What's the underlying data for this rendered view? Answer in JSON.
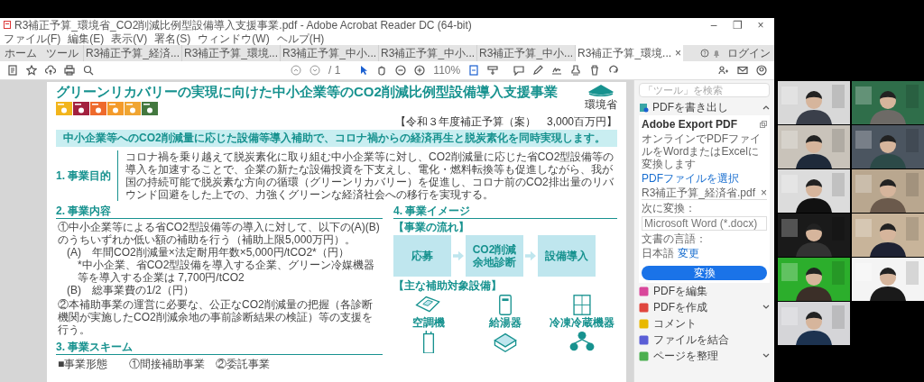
{
  "window": {
    "title": "R3補正予算_環境省_CO2削減比例型設備導入支援事業.pdf - Adobe Acrobat Reader DC (64-bit)",
    "controls": [
      "–",
      "❐",
      "×"
    ]
  },
  "menu": [
    "ファイル(F)",
    "編集(E)",
    "表示(V)",
    "署名(S)",
    "ウィンドウ(W)",
    "ヘルプ(H)"
  ],
  "tabs": [
    {
      "label": "ホーム",
      "selected": false
    },
    {
      "label": "ツール",
      "selected": false
    },
    {
      "label": "R3補正予算_経済...",
      "selected": false
    },
    {
      "label": "R3補正予算_環境...",
      "selected": false
    },
    {
      "label": "R3補正予算_中小...",
      "selected": false
    },
    {
      "label": "R3補正予算_中小...",
      "selected": false
    },
    {
      "label": "R3補正予算_中小...",
      "selected": false
    },
    {
      "label": "R3補正予算_環境...",
      "selected": true,
      "close": "×"
    }
  ],
  "account": {
    "login": "ログイン"
  },
  "toolbar": {
    "page": "/ 1",
    "zoom": "110%"
  },
  "document": {
    "title": "グリーンリカバリーの実現に向けた中小企業等のCO2削減比例型設備導入支援事業",
    "ministry": "環境省",
    "goal_tiles": [
      {
        "color": "#f2b51c"
      },
      {
        "color": "#a3213f"
      },
      {
        "color": "#ee6a2c"
      },
      {
        "color": "#f49b2a"
      },
      {
        "color": "#f0a531"
      },
      {
        "color": "#43783f"
      }
    ],
    "budget": "【令和３年度補正予算（案）　3,000百万円】",
    "summary": "中小企業等へのCO2削減量に応じた設備等導入補助で、コロナ禍からの経済再生と脱炭素化を同時実現します。",
    "purpose": {
      "heading": "1. 事業目的",
      "text": "コロナ禍を乗り越えて脱炭素化に取り組む中小企業等に対し、CO2削減量に応じた省CO2型設備等の導入を加速することで、企業の新たな設備投資を下支えし、電化・燃料転換等も促進しながら、我が国の持続可能で脱炭素な方向の循環（グリーンリカバリー）を促進し、コロナ前のCO2排出量のリバウンド回避をした上での、力強くグリーンな経済社会への移行を実現する。"
    },
    "content": {
      "heading": "2. 事業内容",
      "items": [
        {
          "kind": "main",
          "text": "①中小企業等による省CO2型設備等の導入に対して、以下の(A)(B)のうちいずれか低い額の補助を行う（補助上限5,000万円）。"
        },
        {
          "kind": "sub",
          "text": "(A)　年間CO2削減量×法定耐用年数×5,000円/tCO2*（円）"
        },
        {
          "kind": "note",
          "text": "*中小企業、省CO2型設備を導入する企業、グリーン冷媒機器等を導入する企業は 7,700円/tCO2"
        },
        {
          "kind": "sub",
          "text": "(B)　総事業費の1/2（円）"
        },
        {
          "kind": "main",
          "text": "②本補助事業の運営に必要な、公正なCO2削減量の把握（各診断機関が実施したCO2削減余地の事前診断結果の検証）等の支援を行う。"
        }
      ]
    },
    "scheme": {
      "heading": "3. 事業スキーム",
      "label": "■事業形態",
      "value": "①間接補助事業　②委託事業"
    },
    "image": {
      "heading": "4. 事業イメージ",
      "flow_label": "【事業の流れ】",
      "flow": [
        "応募",
        "CO2削減余地診断",
        "設備導入"
      ],
      "equipment_label": "【主な補助対象設備】",
      "equipment": [
        {
          "kind": "labeled",
          "label": "空調機"
        },
        {
          "kind": "labeled",
          "label": "給湯器"
        },
        {
          "kind": "labeled",
          "label": "冷凍冷蔵機器"
        },
        {
          "kind": "icon"
        },
        {
          "kind": "icon"
        },
        {
          "kind": "icon"
        }
      ]
    }
  },
  "tools_panel": {
    "search_placeholder": "「ツール」を検索",
    "export": {
      "label": "PDFを書き出し",
      "expanded": true,
      "service": "Adobe Export PDF",
      "description": "オンラインでPDFファイルをWordまたはExcelに変換します",
      "select_link": "PDFファイルを選択",
      "file": "R3補正予算_経済省.pdf",
      "remove": "×",
      "convert_label": "次に変換：",
      "format": "Microsoft Word (*.docx)",
      "language_label": "文書の言語：",
      "language": "日本語",
      "change_link": "変更",
      "button": "変換"
    },
    "tools": [
      {
        "label": "PDFを編集",
        "color": "#d9479b",
        "expandable": false
      },
      {
        "label": "PDFを作成",
        "color": "#e0463e",
        "expandable": true
      },
      {
        "label": "コメント",
        "color": "#e8b800",
        "expandable": false
      },
      {
        "label": "ファイルを結合",
        "color": "#5a5ed6",
        "expandable": false
      },
      {
        "label": "ページを整理",
        "color": "#4caf50",
        "expandable": true
      }
    ]
  }
}
